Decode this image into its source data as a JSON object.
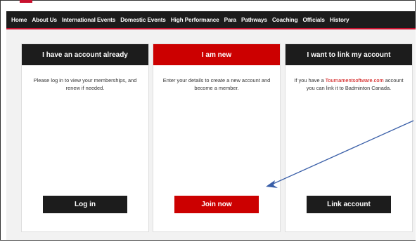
{
  "nav": {
    "items": [
      "Home",
      "About Us",
      "International Events",
      "Domestic Events",
      "High Performance",
      "Para",
      "Pathways",
      "Coaching",
      "Officials",
      "History"
    ]
  },
  "cards": [
    {
      "title": "I have an account already",
      "body": "Please log in to view your memberships, and renew if needed.",
      "button": "Log in"
    },
    {
      "title": "I am new",
      "body": "Enter your details to create a new account and become a member.",
      "button": "Join now"
    },
    {
      "title": "I want to link my account",
      "body_prefix": "If you have a ",
      "body_link": "Tournamentsoftware.com",
      "body_suffix": " account you can link it to Badminton Canada.",
      "button": "Link account"
    }
  ],
  "colors": {
    "nav_bg": "#1c1c1c",
    "accent_red": "#cc0000",
    "annotation_arrow": "#3a5fa8"
  }
}
